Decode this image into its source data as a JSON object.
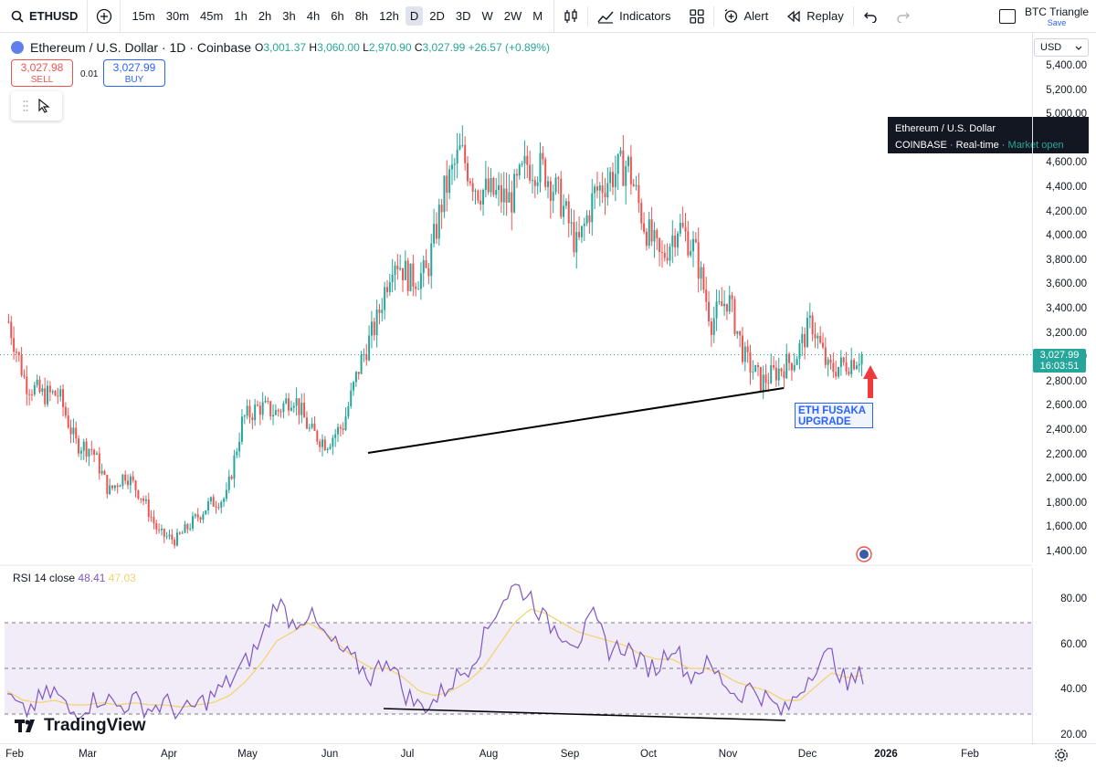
{
  "toolbar": {
    "symbol": "ETHUSD",
    "intervals": [
      "15m",
      "30m",
      "45m",
      "1h",
      "2h",
      "3h",
      "4h",
      "6h",
      "8h",
      "12h",
      "D",
      "2D",
      "3D",
      "W",
      "2W",
      "M"
    ],
    "active_interval": "D",
    "indicators_label": "Indicators",
    "alert_label": "Alert",
    "replay_label": "Replay",
    "layout_name": "BTC Triangle",
    "layout_save": "Save"
  },
  "legend": {
    "title": "Ethereum / U.S. Dollar · 1D · Coinbase",
    "o_label": "O",
    "o_value": "3,001.37",
    "h_label": "H",
    "h_value": "3,060.00",
    "l_label": "L",
    "l_value": "2,970.90",
    "c_label": "C",
    "c_value": "3,027.99",
    "change": "+26.57 (+0.89%)"
  },
  "trade": {
    "sell_price": "3,027.98",
    "sell_label": "SELL",
    "spread": "0.01",
    "buy_price": "3,027.99",
    "buy_label": "BUY"
  },
  "symbol_tooltip": {
    "name": "Ethereum / U.S. Dollar",
    "exchange": "COINBASE",
    "feed": "Real-time",
    "status": "Market open"
  },
  "price_axis": {
    "currency": "USD",
    "labels": [
      "5,400.00",
      "5,200.00",
      "5,000.00",
      "4,800.00",
      "4,600.00",
      "4,400.00",
      "4,200.00",
      "4,000.00",
      "3,800.00",
      "3,600.00",
      "3,400.00",
      "3,200.00",
      "3,000.00",
      "2,800.00",
      "2,600.00",
      "2,400.00",
      "2,200.00",
      "2,000.00",
      "1,800.00",
      "1,600.00",
      "1,400.00"
    ],
    "last_price": "3,027.99",
    "countdown": "16:03:51"
  },
  "annotation": {
    "line1": "ETH FUSAKA",
    "line2": "UPGRADE"
  },
  "rsi": {
    "label": "RSI 14 close",
    "value": "48.41",
    "ma_value": "47.03",
    "axis_labels": [
      "80.00",
      "60.00",
      "40.00",
      "20.00"
    ]
  },
  "date_axis": {
    "labels": [
      "Feb",
      "Mar",
      "Apr",
      "May",
      "Jun",
      "Jul",
      "Aug",
      "Sep",
      "Oct",
      "Nov",
      "Dec",
      "2026",
      "Feb"
    ]
  },
  "branding": {
    "logo_text": "TradingView"
  },
  "colors": {
    "up": "#26a69a",
    "down": "#ef5350",
    "rsi_line": "#7e57c2",
    "rsi_ma": "#f2d36a",
    "rsi_band": "#ede7f6",
    "accent": "#2962ff"
  },
  "chart_data": [
    {
      "type": "candlestick",
      "title": "Ethereum / U.S. Dollar · 1D · Coinbase",
      "x": [
        "Feb",
        "Mar",
        "Apr",
        "May",
        "Jun",
        "Jul",
        "Aug",
        "Sep",
        "Oct",
        "Nov",
        "Dec",
        "2026",
        "Feb"
      ],
      "y_unit": "USD",
      "ylim": [
        1300,
        5500
      ],
      "series": [
        {
          "values_close": [
            3300,
            2800,
            2700,
            2700,
            2300,
            2250,
            1900,
            2050,
            1850,
            1550,
            1500,
            1650,
            1800,
            1850,
            2500,
            2600,
            2550,
            2700,
            2400,
            2300,
            2450,
            2950,
            3300,
            3850,
            3650,
            3700,
            4350,
            4700,
            4400,
            4350,
            4300,
            4600,
            4550,
            4300,
            3900,
            4350,
            4500,
            4600,
            4100,
            3800,
            4100,
            3900,
            3300,
            3500,
            3000,
            2800,
            2900,
            3000,
            3300,
            2900,
            2950,
            3028
          ],
          "note": "approximate weekly closes read from the price axis"
        }
      ]
    },
    {
      "type": "line",
      "title": "RSI 14 close",
      "ylim": [
        18,
        90
      ],
      "series": [
        {
          "name": "RSI 14 close",
          "values": [
            38,
            30,
            36,
            40,
            30,
            34,
            38,
            33,
            36,
            32,
            35,
            30,
            34,
            38,
            44,
            52,
            62,
            80,
            70,
            74,
            64,
            58,
            52,
            46,
            56,
            40,
            33,
            36,
            44,
            50,
            62,
            78,
            86,
            82,
            70,
            66,
            62,
            72,
            58,
            60,
            52,
            50,
            62,
            46,
            52,
            46,
            38,
            42,
            36,
            30,
            40,
            52,
            56,
            42,
            48
          ]
        },
        {
          "name": "MA",
          "values": [
            40,
            36,
            35,
            36,
            34,
            34,
            35,
            34,
            35,
            34,
            34,
            33,
            34,
            35,
            38,
            44,
            52,
            62,
            66,
            70,
            66,
            60,
            54,
            50,
            50,
            46,
            40,
            38,
            40,
            44,
            50,
            60,
            70,
            76,
            74,
            70,
            66,
            64,
            62,
            60,
            56,
            54,
            54,
            50,
            50,
            48,
            44,
            42,
            40,
            36,
            36,
            42,
            48,
            46,
            47
          ]
        }
      ],
      "levels": [
        70,
        50,
        30
      ]
    }
  ]
}
